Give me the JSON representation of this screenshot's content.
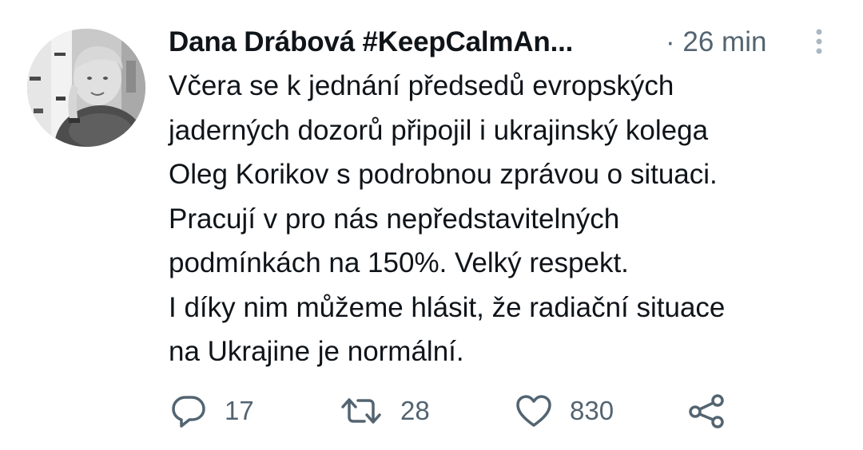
{
  "tweet": {
    "author_name": "Dana Drábová #KeepCalmAn...",
    "time": "· 26 min",
    "text_lines": [
      "Včera se k jednání předsedů evropských",
      "jaderných dozorů připojil i ukrajinský kolega",
      "Oleg Korikov s podrobnou zprávou o situaci.",
      "Pracují v pro nás nepředstavitelných",
      "podmínkách na 150%. Velký respekt.",
      "I díky nim můžeme hlásit, že radiační situace",
      "na Ukrajine je normální."
    ]
  },
  "actions": {
    "reply": {
      "icon": "reply-icon",
      "count": "17"
    },
    "retweet": {
      "icon": "retweet-icon",
      "count": "28"
    },
    "like": {
      "icon": "heart-icon",
      "count": "830"
    },
    "share": {
      "icon": "share-icon"
    }
  },
  "colors": {
    "text": "#0f1419",
    "secondary": "#536471",
    "more_dots": "#aab8c2",
    "background": "#ffffff"
  }
}
